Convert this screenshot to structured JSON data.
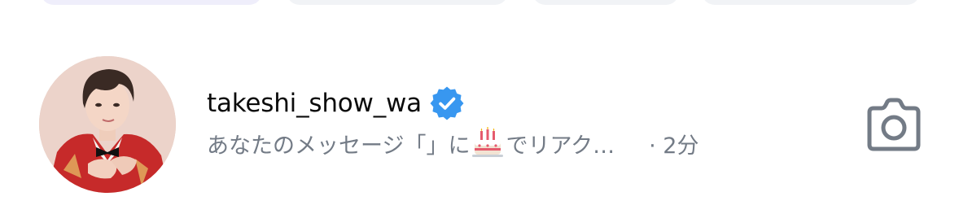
{
  "filter_chips": [
    "",
    "",
    "",
    ""
  ],
  "thread": {
    "username": "takeshi_show_wa",
    "verified": true,
    "preview_before": "あなたのメッセージ「」に",
    "preview_emoji": "cake-icon",
    "preview_after": "でリアク…",
    "timestamp": "· 2分"
  },
  "colors": {
    "username": "#0b0b0b",
    "secondary_text": "#737b86",
    "verified_badge": "#3897f0",
    "camera_icon": "#737b86"
  }
}
